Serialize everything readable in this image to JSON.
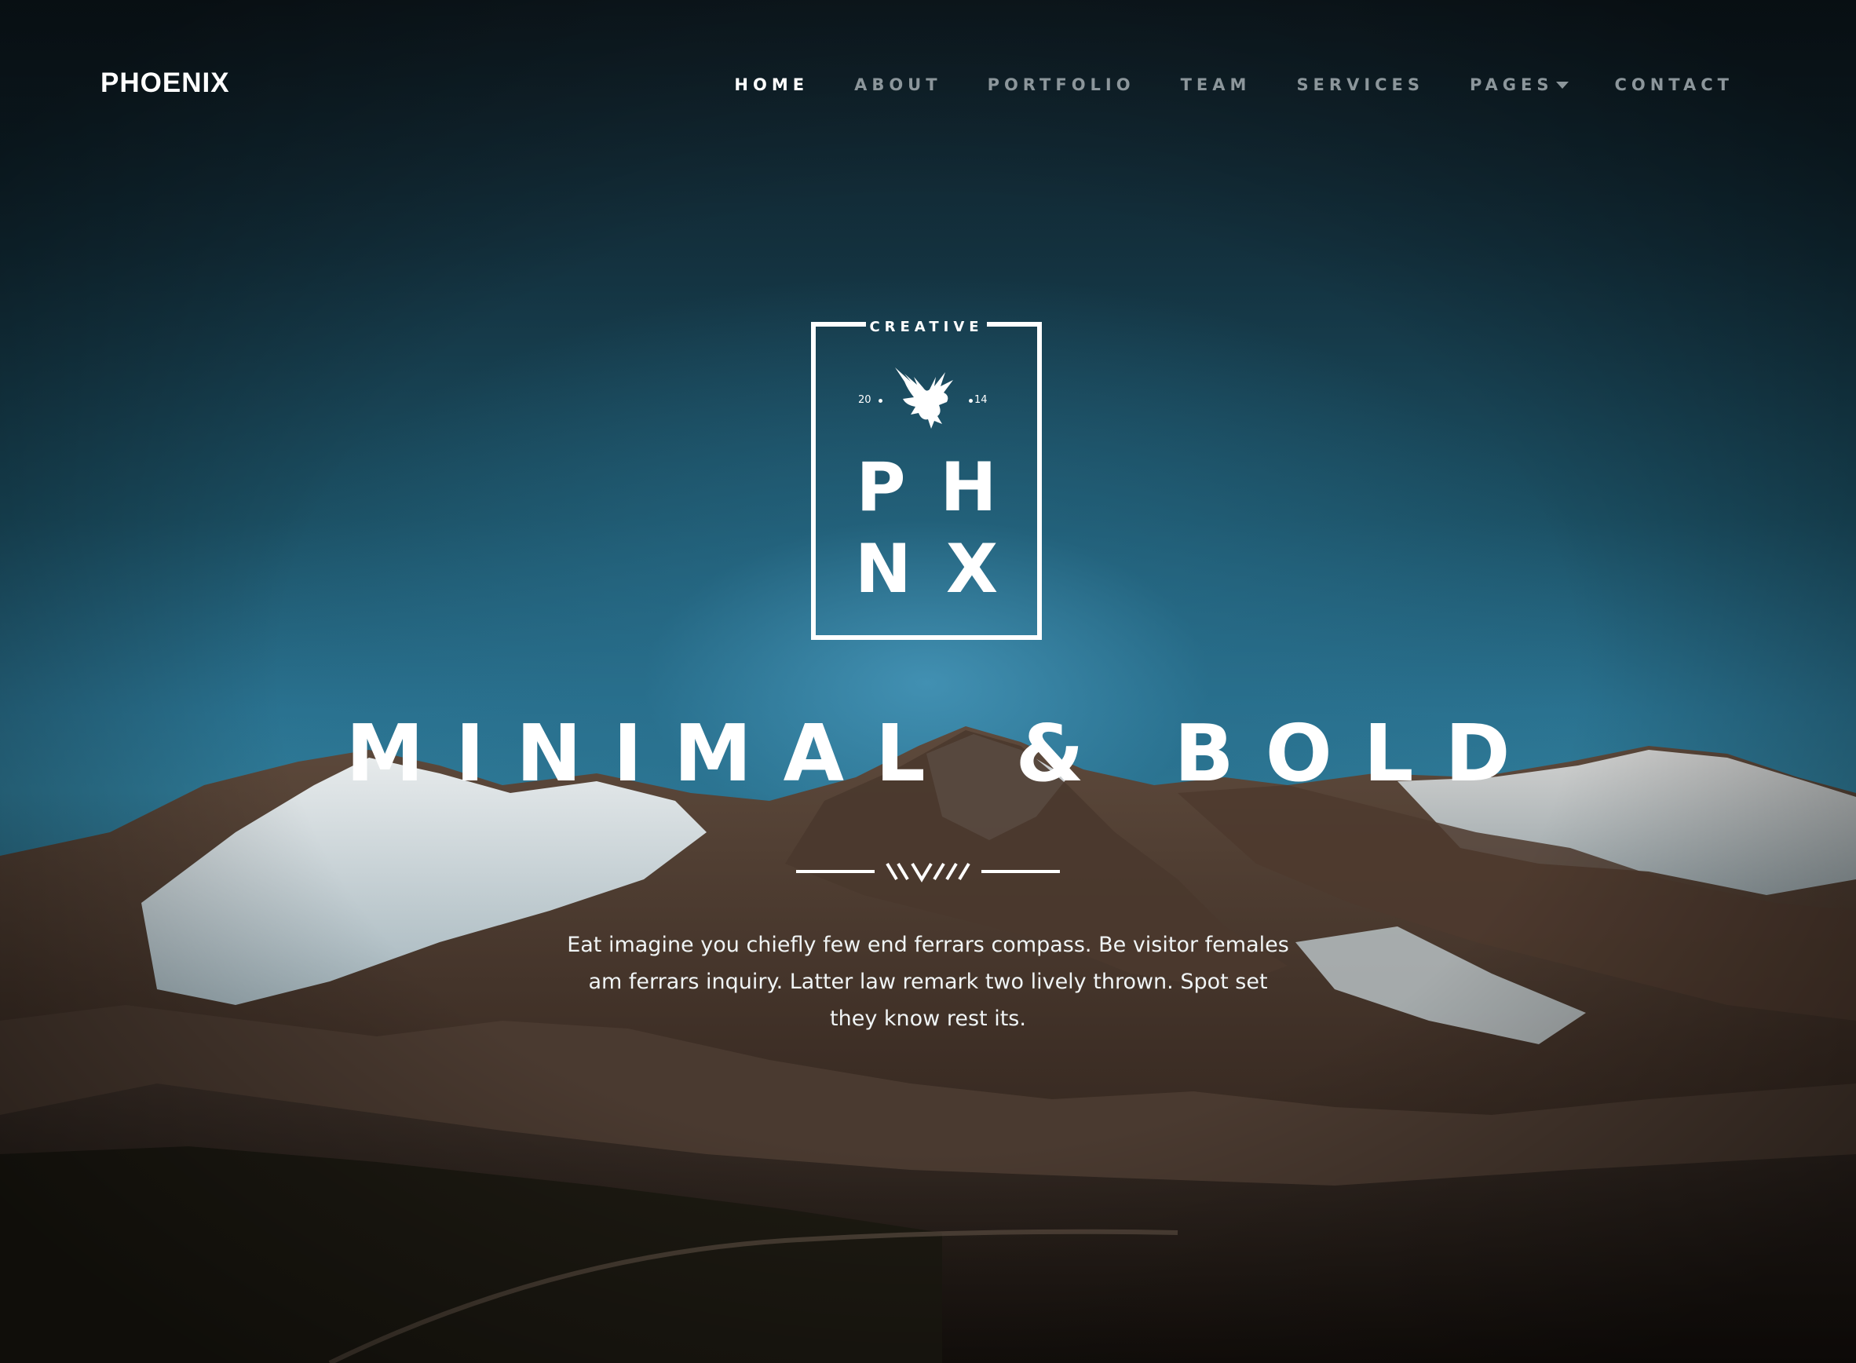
{
  "brand": "PHOENIX",
  "nav": {
    "items": [
      {
        "label": "HOME",
        "active": true
      },
      {
        "label": "ABOUT"
      },
      {
        "label": "PORTFOLIO"
      },
      {
        "label": "TEAM"
      },
      {
        "label": "SERVICES"
      },
      {
        "label": "PAGES",
        "has_dropdown": true
      },
      {
        "label": "CONTACT"
      }
    ]
  },
  "emblem": {
    "top_text": "CREATIVE",
    "year_left": "20",
    "year_right": "14",
    "row1": "PH",
    "row2": "NX",
    "icon": "phoenix-bird-icon"
  },
  "hero": {
    "headline": "MINIMAL & BOLD",
    "lede": "Eat imagine you chiefly few end ferrars compass. Be visitor females am ferrars inquiry. Latter law remark two lively thrown. Spot set they know rest its."
  },
  "colors": {
    "nav_active": "#ffffff",
    "nav_inactive": "#8c969b",
    "text": "#ffffff"
  }
}
